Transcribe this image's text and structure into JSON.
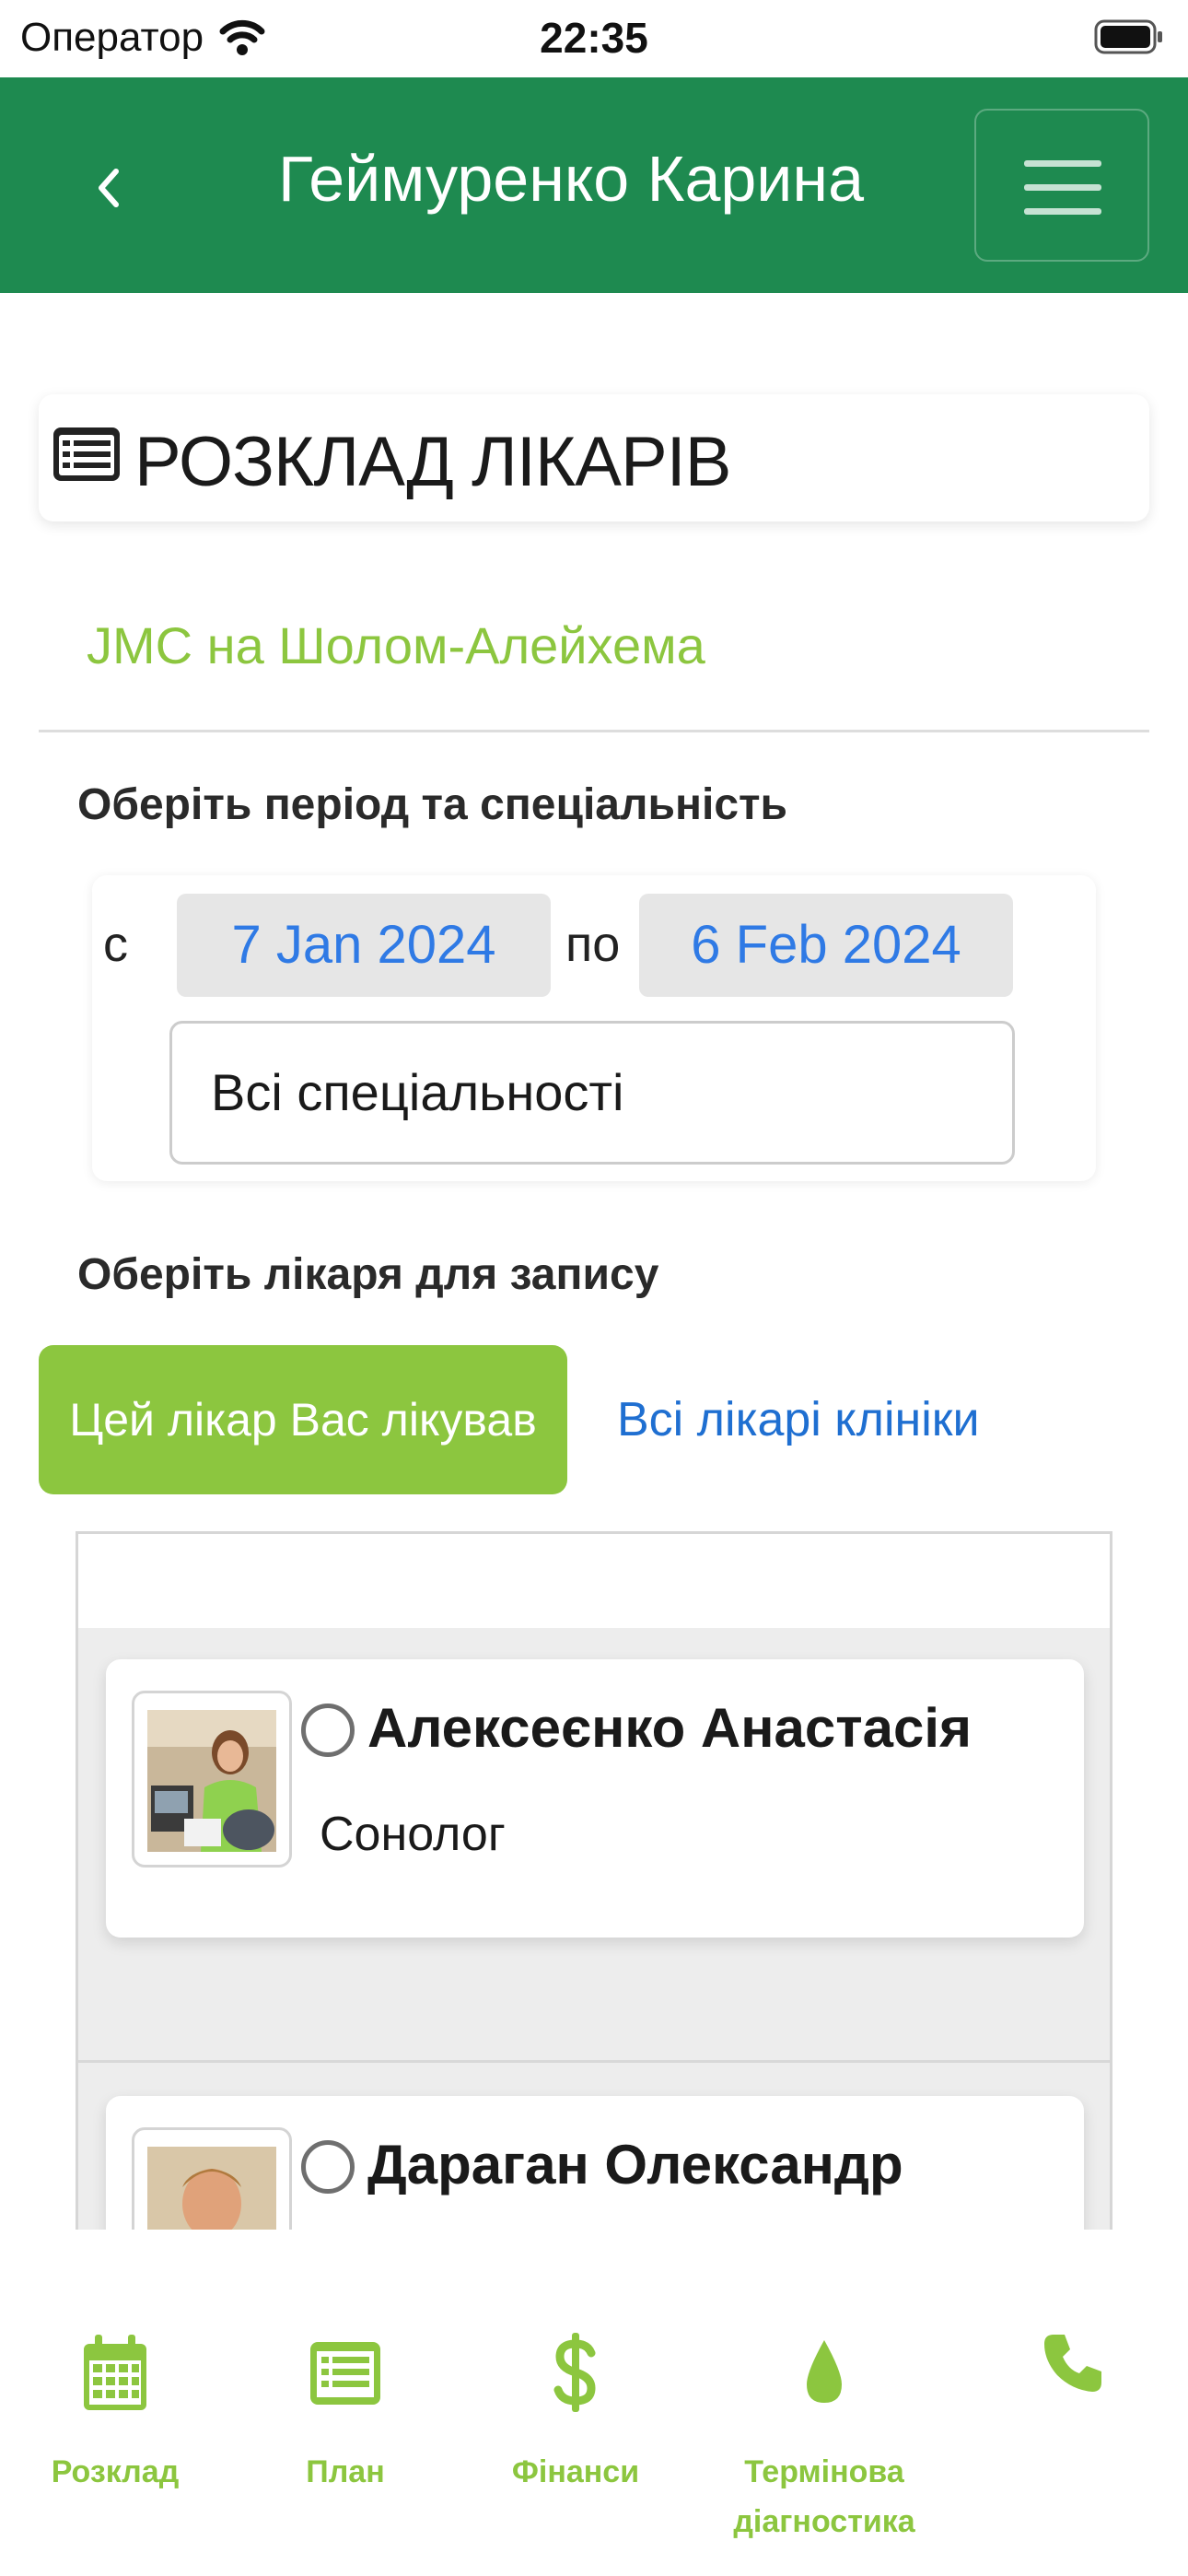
{
  "status_bar": {
    "carrier": "Оператор",
    "time": "22:35"
  },
  "header": {
    "title": "Геймуренко Карина"
  },
  "page": {
    "title": "РОЗКЛАД ЛІКАРІВ",
    "clinic": "JMC на Шолом-Алейхема"
  },
  "period": {
    "section_label": "Оберіть період та спеціальність",
    "from_label": "с",
    "from_date": "7 Jan 2024",
    "to_label": "по",
    "to_date": "6 Feb 2024",
    "speciality": "Всі спеціальності"
  },
  "doctor_select": {
    "section_label": "Оберіть лікаря для запису",
    "tab_treated": "Цей лікар Вас лікував",
    "tab_all": "Всі лікарі клініки"
  },
  "doctors": [
    {
      "name": "Алексеєнко Анастасія",
      "speciality": "Сонолог"
    },
    {
      "name": "Дараган Олександр",
      "speciality": ""
    }
  ],
  "bottom_nav": [
    {
      "label": "Розклад",
      "icon": "calendar-icon"
    },
    {
      "label": "План",
      "icon": "list-icon"
    },
    {
      "label": "Фінанси",
      "icon": "dollar-icon"
    },
    {
      "label": "Термінова діагностика",
      "icon": "drop-icon"
    },
    {
      "label": "",
      "icon": "phone-icon"
    }
  ],
  "colors": {
    "header_green": "#1e8a50",
    "accent_lime": "#8cc63f",
    "link_blue": "#1f6fd1",
    "date_blue": "#2f7ae5"
  }
}
